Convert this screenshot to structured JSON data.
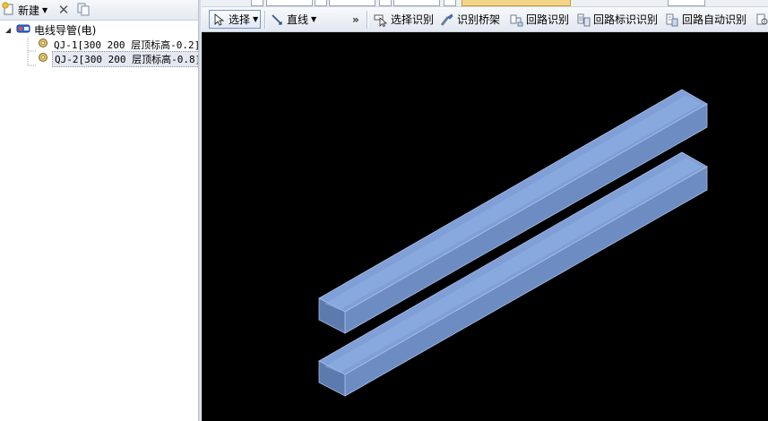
{
  "left_toolbar": {
    "new_label": "新建",
    "new_icon": "new-document-icon",
    "delete_icon": "delete-x-icon",
    "copy_icon": "copy-icon"
  },
  "tree": {
    "root": {
      "label": "电线导管(电)",
      "expanded": true,
      "icon": "conduit-icon"
    },
    "items": [
      {
        "label": "QJ-1[300 200 层顶标高-0.2]",
        "icon": "component-gear-icon",
        "selected": false
      },
      {
        "label": "QJ-2[300 200 层顶标高-0.8]",
        "icon": "component-gear-icon",
        "selected": true
      }
    ]
  },
  "toolbar": {
    "select_label": "选择",
    "line_label": "直线",
    "more_label": "»",
    "select_recognize_label": "选择识别",
    "recognize_bridge_label": "识别桥架",
    "circuit_recognize_label": "回路识别",
    "circuit_label_recognize_label": "回路标识识别",
    "circuit_auto_recognize_label": "回路自动识别"
  },
  "canvas": {
    "background": "#000000",
    "object_color": "#7a9fdb",
    "objects": [
      "cable-tray-QJ-1",
      "cable-tray-QJ-2"
    ]
  }
}
